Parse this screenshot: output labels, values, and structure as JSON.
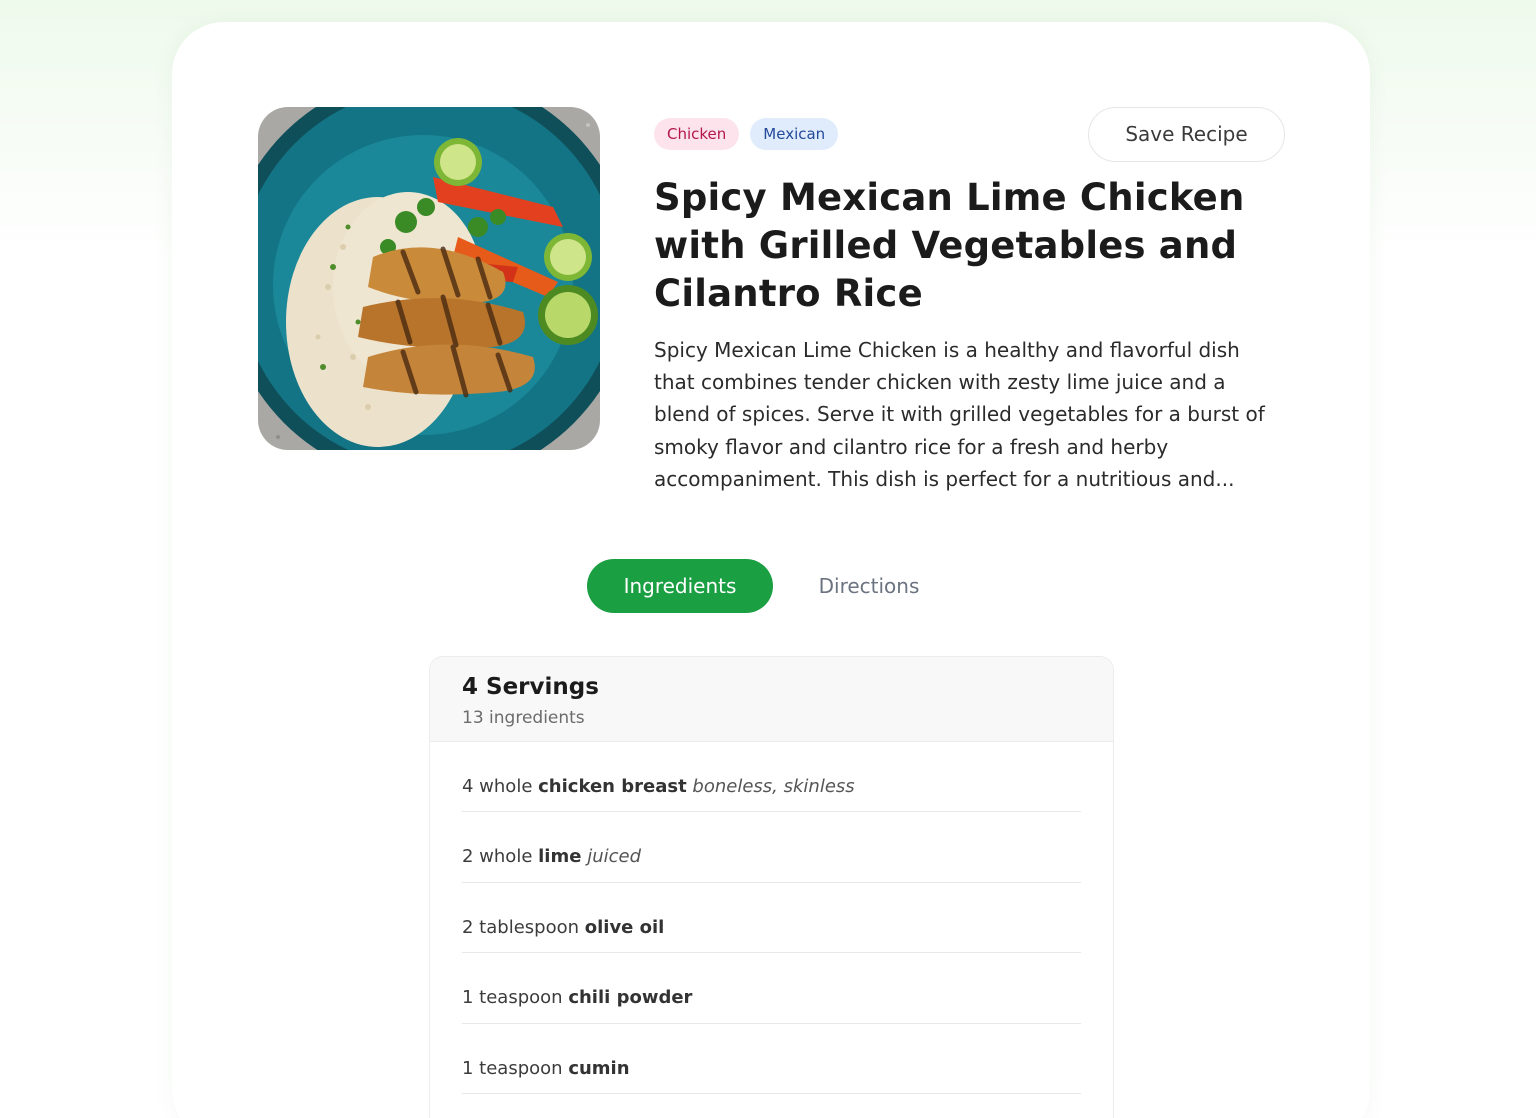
{
  "recipe": {
    "tags": [
      "Chicken",
      "Mexican"
    ],
    "save_label": "Save Recipe",
    "title": "Spicy Mexican Lime Chicken with Grilled Vegetables and Cilantro Rice",
    "description": "Spicy Mexican Lime Chicken is a healthy and flavorful dish that combines tender chicken with zesty lime juice and a blend of spices. Serve it with grilled vegetables for a burst of smoky flavor and cilantro rice for a fresh and herby accompaniment. This dish is perfect for a nutritious and...",
    "tag_colors": {
      "Chicken": "#b3174a",
      "Mexican": "#23499a"
    },
    "accent_color": "#1a9f43"
  },
  "tabs": {
    "ingredients": "Ingredients",
    "directions": "Directions",
    "active": "Ingredients"
  },
  "ingredients_panel": {
    "servings": "4 Servings",
    "count": "13 ingredients",
    "items": [
      {
        "amount": "4 whole",
        "name": "chicken breast",
        "note": "boneless, skinless"
      },
      {
        "amount": "2 whole",
        "name": "lime",
        "note": "juiced"
      },
      {
        "amount": "2 tablespoon",
        "name": "olive oil",
        "note": ""
      },
      {
        "amount": "1 teaspoon",
        "name": "chili powder",
        "note": ""
      },
      {
        "amount": "1 teaspoon",
        "name": "cumin",
        "note": ""
      }
    ]
  }
}
